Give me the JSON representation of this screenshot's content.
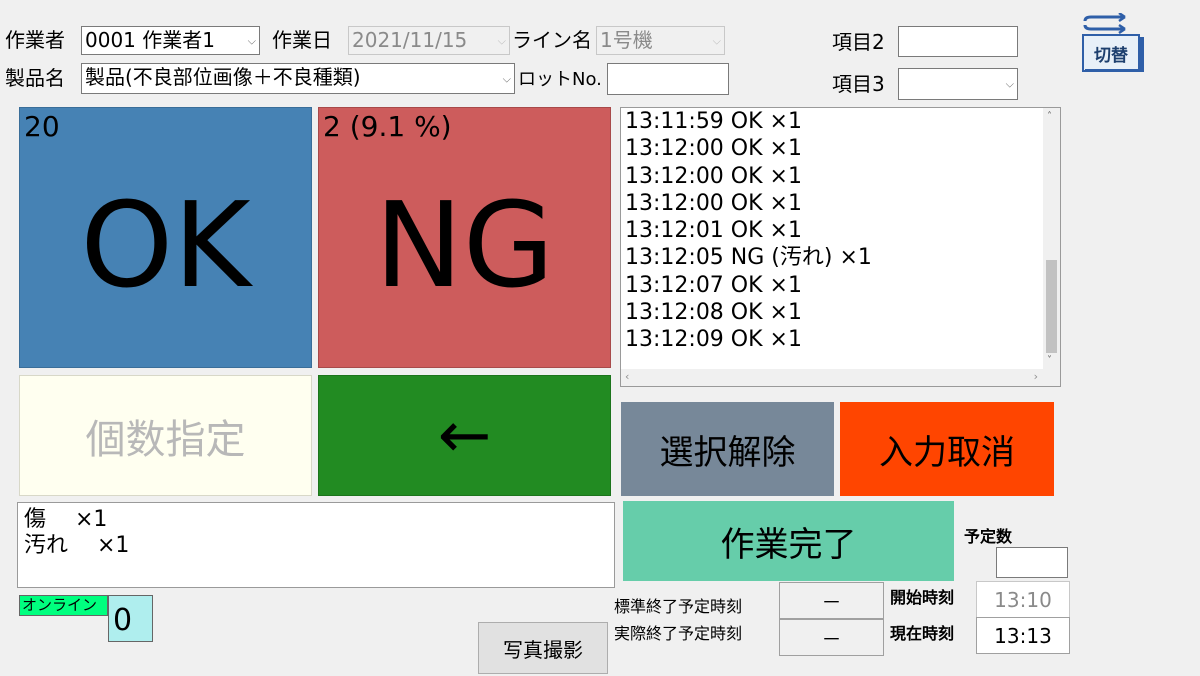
{
  "header": {
    "worker_label": "作業者",
    "worker_value": "0001 作業者1",
    "date_label": "作業日",
    "date_value": "2021/11/15",
    "line_label": "ライン名",
    "line_value": "1号機",
    "item2_label": "項目2",
    "item2_value": "",
    "item3_label": "項目3",
    "item3_value": "",
    "product_label": "製品名",
    "product_value": "製品(不良部位画像＋不良種類)",
    "lot_label": "ロットNo.",
    "lot_value": "",
    "switch_label": "切替"
  },
  "counters": {
    "ok_count": "20",
    "ok_label": "OK",
    "ng_count": "2 (9.1 %)",
    "ng_label": "NG"
  },
  "log": [
    "13:11:59 OK ×1",
    "13:12:00 OK ×1",
    "13:12:00 OK ×1",
    "13:12:00 OK ×1",
    "13:12:01 OK ×1",
    "13:12:05 NG (汚れ) ×1",
    "13:12:07 OK ×1",
    "13:12:08 OK ×1",
    "13:12:09 OK ×1"
  ],
  "buttons": {
    "quantity": "個数指定",
    "back": "←",
    "deselect": "選択解除",
    "cancel_input": "入力取消",
    "complete": "作業完了",
    "photo": "写真撮影"
  },
  "defects": [
    "傷　 ×1",
    "汚れ　 ×1"
  ],
  "status": {
    "online_label": "オンライン",
    "online_count": "0"
  },
  "schedule": {
    "planned_qty_label": "予定数",
    "planned_qty_value": "",
    "std_end_label": "標準終了予定時刻",
    "std_end_value": "－",
    "actual_end_label": "実際終了予定時刻",
    "actual_end_value": "－",
    "start_label": "開始時刻",
    "start_value": "13:10",
    "now_label": "現在時刻",
    "now_value": "13:13"
  },
  "colors": {
    "ok_bg": "#4682b4",
    "ng_bg": "#cd5c5c",
    "quantity_bg": "#fffff0",
    "back_bg": "#228b22",
    "deselect_bg": "#778899",
    "cancel_bg": "#ff4500",
    "complete_bg": "#66cdaa",
    "online_bg": "#00ff7f",
    "online_count_bg": "#afeeee"
  }
}
